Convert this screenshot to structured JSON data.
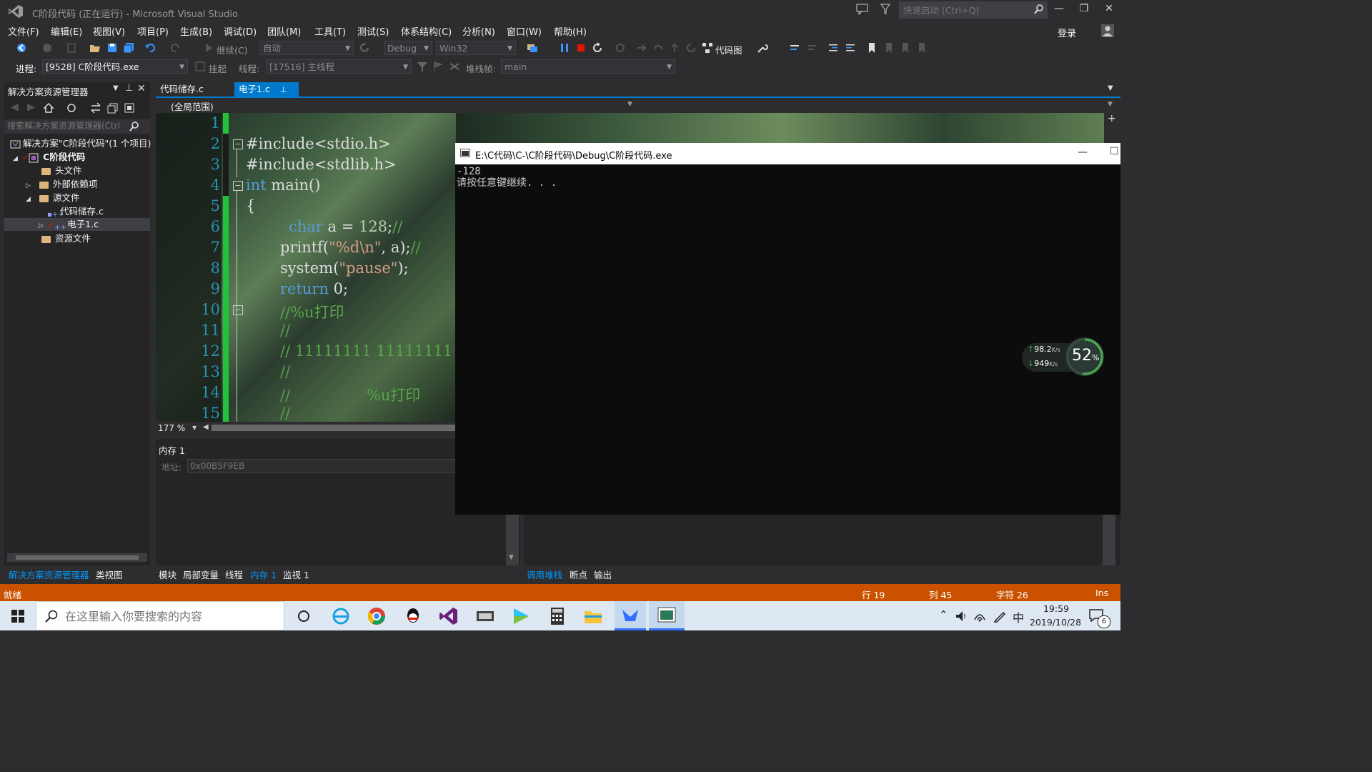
{
  "window": {
    "title": "C阶段代码 (正在运行) - Microsoft Visual Studio",
    "quick_launch_placeholder": "快速启动 (Ctrl+Q)",
    "login": "登录"
  },
  "menu": [
    "文件(F)",
    "编辑(E)",
    "视图(V)",
    "项目(P)",
    "生成(B)",
    "调试(D)",
    "团队(M)",
    "工具(T)",
    "测试(S)",
    "体系结构(C)",
    "分析(N)",
    "窗口(W)",
    "帮助(H)"
  ],
  "toolbar": {
    "continue_label": "继续(C)",
    "auto_combo": "自动",
    "config_combo": "Debug",
    "platform_combo": "Win32",
    "codemap_label": "代码图",
    "process_label": "进程:",
    "process_value": "[9528] C阶段代码.exe",
    "suspend_label": "挂起",
    "thread_label": "线程:",
    "thread_value": "[17516] 主线程",
    "stackframe_label": "堆栈帧:",
    "stackframe_value": "main"
  },
  "solution_explorer": {
    "title": "解决方案资源管理器",
    "search_placeholder": "搜索解决方案资源管理器(Ctrl",
    "items": [
      {
        "label": "解决方案\"C阶段代码\"(1 个项目)"
      },
      {
        "label": "C阶段代码"
      },
      {
        "label": "头文件"
      },
      {
        "label": "外部依赖项"
      },
      {
        "label": "源文件"
      },
      {
        "label": "代码储存.c"
      },
      {
        "label": "电子1.c"
      },
      {
        "label": "资源文件"
      }
    ],
    "bottom_tabs": [
      "解决方案资源管理器",
      "类视图"
    ]
  },
  "editor": {
    "tabs": [
      "代码储存.c",
      "电子1.c"
    ],
    "scope": "(全局范围)",
    "zoom": "177 %",
    "line_numbers": [
      "1",
      "2",
      "3",
      "4",
      "5",
      "6",
      "7",
      "8",
      "9",
      "10",
      "11",
      "12",
      "13",
      "14",
      "15"
    ],
    "lines": {
      "l2": "#include<stdio.h>",
      "l3": "#include<stdlib.h>",
      "l4_kw": "int",
      "l4_rest": " main()",
      "l5": "{",
      "l6_kw": "char",
      "l6_rest": " a = ",
      "l6_num": "128",
      "l6_end": ";",
      "l6_cm": "//",
      "l7_a": "printf(",
      "l7_str": "\"%d\\n\"",
      "l7_b": ", a);",
      "l7_cm": "//",
      "l8_a": "system(",
      "l8_str": "\"pause\"",
      "l8_b": ");",
      "l9_kw": "return",
      "l9_rest": " 0;",
      "l10": "//%u打印",
      "l11": "//",
      "l12": "// 11111111 11111111",
      "l13": "//",
      "l14": "//                %u打印",
      "l15": "//"
    }
  },
  "memory_panel": {
    "title": "内存 1",
    "address_label": "地址:",
    "address_value": "0x00B5F9EB",
    "bottom_tabs": [
      "模块",
      "局部变量",
      "线程",
      "内存 1",
      "监视 1"
    ]
  },
  "call_panel": {
    "bottom_tabs": [
      "调用堆栈",
      "断点",
      "输出"
    ]
  },
  "console": {
    "title": "E:\\C代码\\C-\\C阶段代码\\Debug\\C阶段代码.exe",
    "line1": "-128",
    "line2": "请按任意键继续. . ."
  },
  "net_widget": {
    "up": "98.2",
    "down": "949",
    "unit": "K/s",
    "percent": "52",
    "percent_sign": "%"
  },
  "statusbar": {
    "ready": "就绪",
    "line": "行 19",
    "col": "列 45",
    "char": "字符 26",
    "ins": "Ins"
  },
  "taskbar": {
    "search_placeholder": "在这里输入你要搜索的内容",
    "ime": "中",
    "time": "19:59",
    "date": "2019/10/28",
    "notif_count": "6"
  },
  "colors": {
    "accent": "#007acc",
    "status": "#ca5100",
    "keyword": "#569cd6",
    "comment": "#57a64a",
    "string": "#d69d85"
  }
}
